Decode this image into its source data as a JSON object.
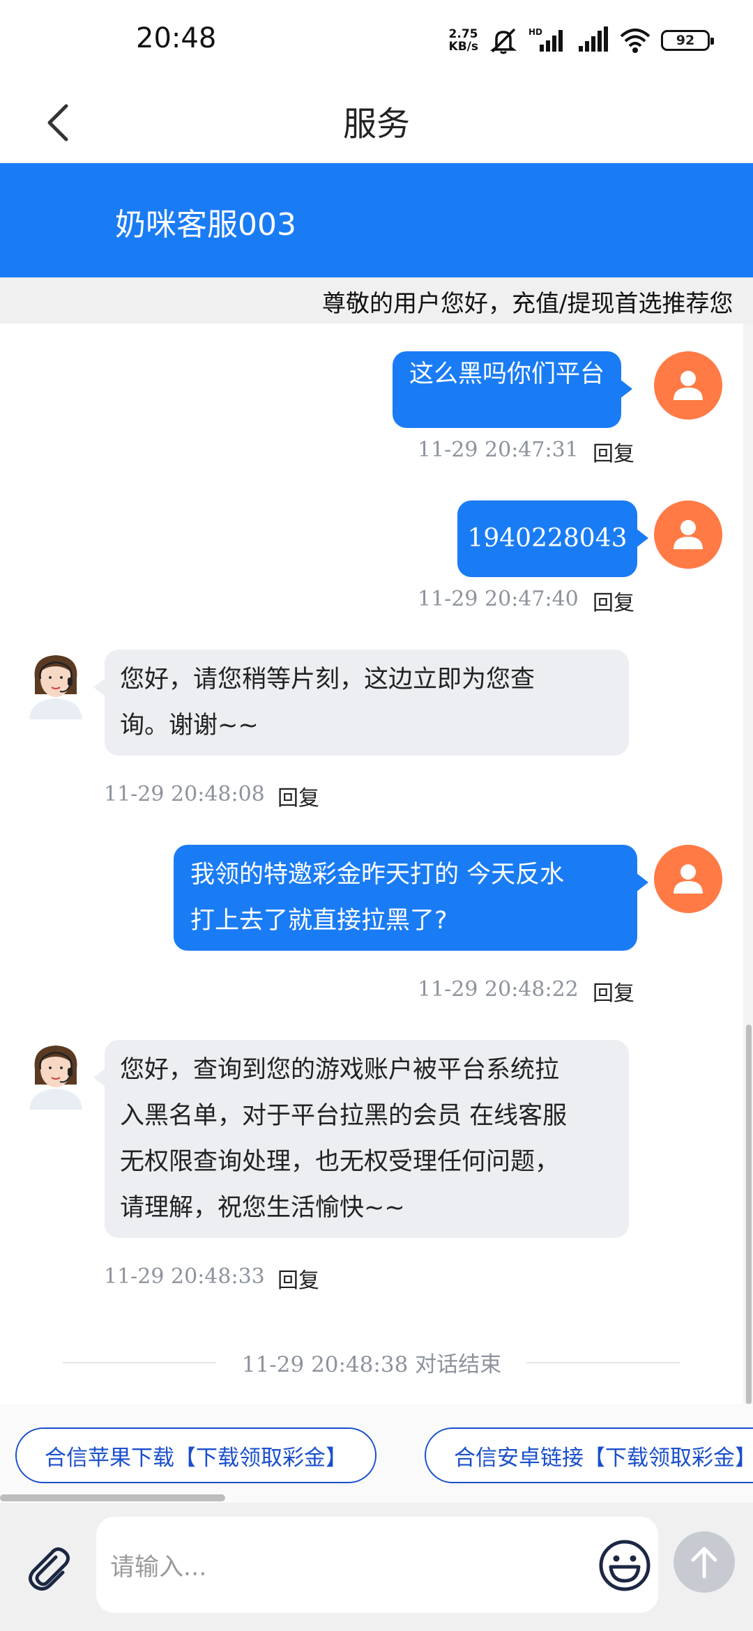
{
  "status_bar": {
    "time": "20:48",
    "net_speed_value": "2.75",
    "net_speed_unit": "KB/s",
    "battery": "92",
    "icons": [
      "mute-icon",
      "hd-signal-icon",
      "signal-icon",
      "wifi-icon",
      "battery-icon"
    ]
  },
  "header": {
    "title": "服务",
    "back_icon": "chevron-left-icon"
  },
  "agent_banner": {
    "name": "奶咪客服003"
  },
  "notice": {
    "text": "尊敬的用户您好，充值/提现首选推荐您"
  },
  "messages": [
    {
      "sender": "user",
      "text": "这么黑吗你们平台",
      "time": "11-29 20:47:31",
      "reply": "回复"
    },
    {
      "sender": "user",
      "text": "1940228043",
      "time": "11-29 20:47:40",
      "reply": "回复"
    },
    {
      "sender": "agent",
      "lines": [
        "您好，请您稍等片刻，这边立即为您查",
        "询。谢谢~~"
      ],
      "time": "11-29 20:48:08",
      "reply": "回复"
    },
    {
      "sender": "user",
      "lines": [
        "我领的特邀彩金昨天打的 今天反水",
        "打上去了就直接拉黑了?"
      ],
      "time": "11-29 20:48:22",
      "reply": "回复"
    },
    {
      "sender": "agent",
      "lines": [
        "您好，查询到您的游戏账户被平台系统拉",
        "入黑名单，对于平台拉黑的会员 在线客服",
        "无权限查询处理，也无权受理任何问题，",
        "请理解，祝您生活愉快~~"
      ],
      "time": "11-29 20:48:33",
      "reply": "回复"
    }
  ],
  "conversation_end": {
    "time": "11-29 20:48:38",
    "text": "对话结束"
  },
  "quick_links": [
    {
      "label": "合信苹果下载【下载领取彩金】"
    },
    {
      "label": "合信安卓链接【下载领取彩金】"
    }
  ],
  "input": {
    "placeholder": "请输入...",
    "attach_icon": "paperclip-icon",
    "emoji_icon": "smiley-icon",
    "send_icon": "arrow-up-icon"
  },
  "colors": {
    "brand_blue": "#1a7cf5",
    "user_avatar": "#ff7a45",
    "agent_bubble": "#eceef1",
    "link_blue": "#1a4fcc"
  }
}
